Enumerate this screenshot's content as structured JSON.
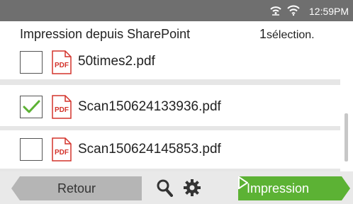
{
  "status_bar": {
    "time": "12:59PM",
    "icons": [
      "wifi-direct-icon",
      "wifi-icon"
    ]
  },
  "header": {
    "title": "Impression depuis SharePoint",
    "selection_count": "1",
    "selection_label": "sélection."
  },
  "files": [
    {
      "name": "50times2.pdf",
      "checked": false,
      "icon": "pdf-icon",
      "icon_label": "PDF"
    },
    {
      "name": "Scan150624133936.pdf",
      "checked": true,
      "icon": "pdf-icon",
      "icon_label": "PDF"
    },
    {
      "name": "Scan150624145853.pdf",
      "checked": false,
      "icon": "pdf-icon",
      "icon_label": "PDF"
    }
  ],
  "toolbar": {
    "back_label": "Retour",
    "print_label": "Impression",
    "icons": [
      "search-icon",
      "gear-icon",
      "play-arrow-icon"
    ]
  },
  "colors": {
    "status_bar": "#6f6f6f",
    "accent_green": "#5cb234",
    "pdf_red": "#d4332b",
    "back_button": "#b5b5b5"
  }
}
